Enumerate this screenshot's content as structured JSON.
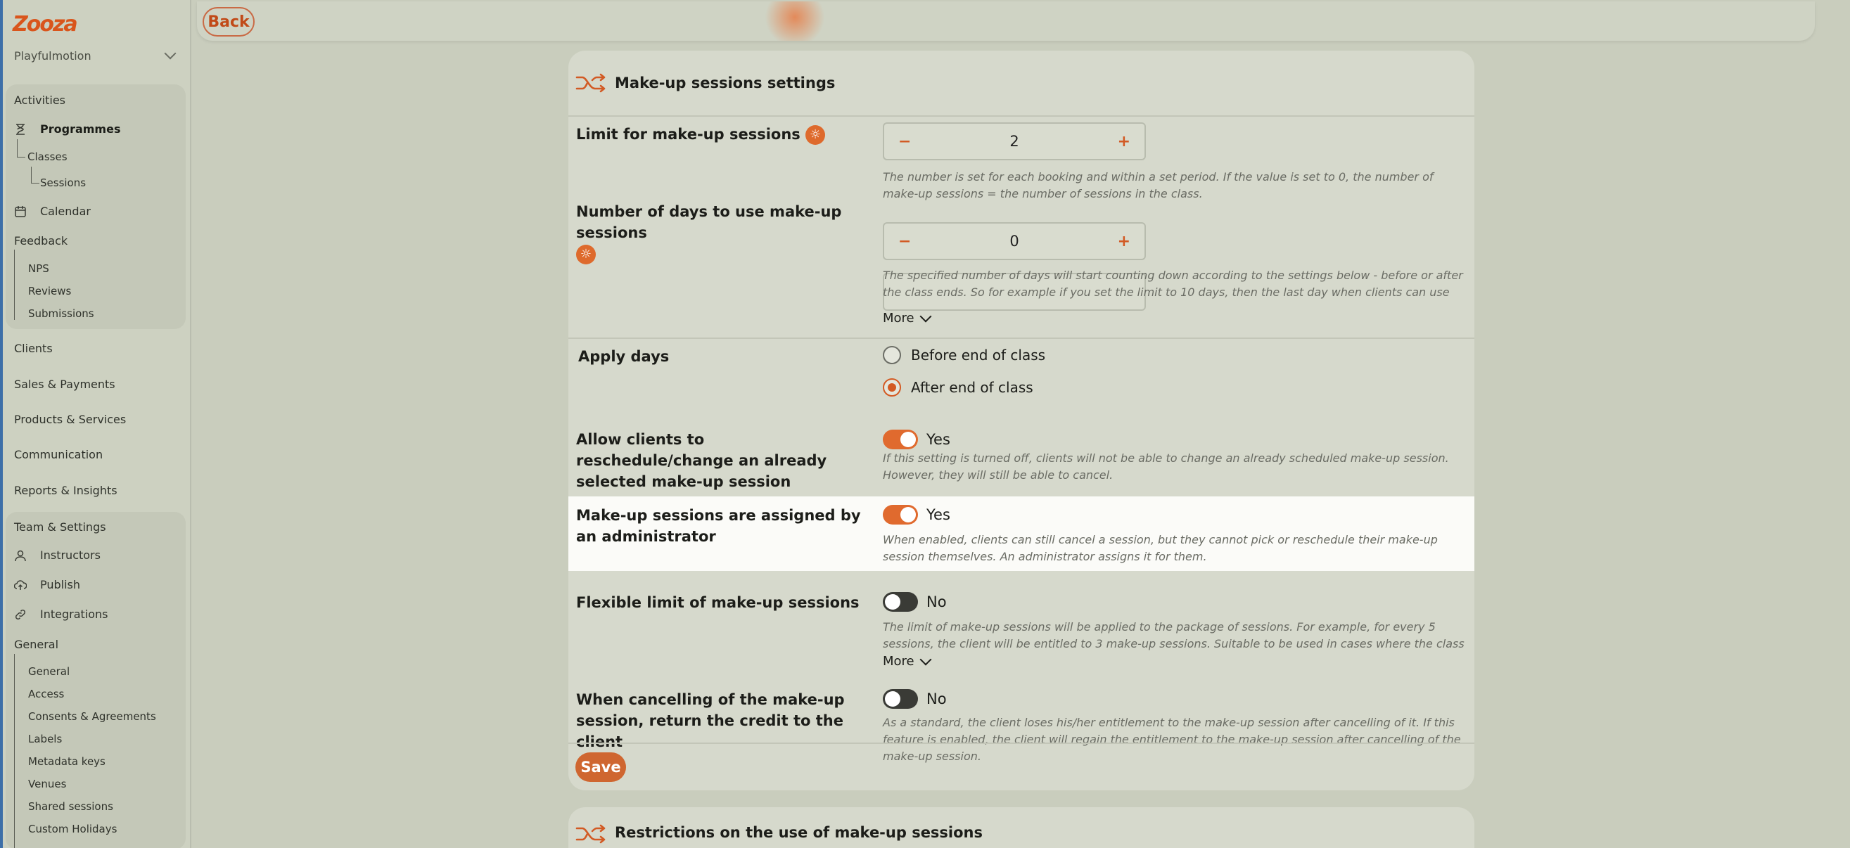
{
  "app": {
    "logo_text": "Zooza",
    "org_name": "Playfulmotion",
    "back_label": "Back"
  },
  "sidebar": {
    "activities": "Activities",
    "programmes": "Programmes",
    "classes": "Classes",
    "sessions": "Sessions",
    "calendar": "Calendar",
    "feedback": "Feedback",
    "nps": "NPS",
    "reviews": "Reviews",
    "submissions": "Submissions",
    "clients": "Clients",
    "sales": "Sales & Payments",
    "products": "Products & Services",
    "communication": "Communication",
    "reports": "Reports & Insights",
    "team": "Team & Settings",
    "instructors": "Instructors",
    "publish": "Publish",
    "integrations": "Integrations",
    "general": "General",
    "general_sub": "General",
    "access": "Access",
    "consents": "Consents & Agreements",
    "labels": "Labels",
    "metadata": "Metadata keys",
    "venues": "Venues",
    "shared_sessions": "Shared sessions",
    "custom_holidays": "Custom Holidays"
  },
  "card": {
    "title": "Make-up sessions settings",
    "limit": {
      "label": "Limit for make-up sessions",
      "value": "2",
      "minus": "−",
      "plus": "+",
      "help": "The number is set for each booking and within a set period. If the value is set to 0, the number of make-up sessions = the number of sessions in the class."
    },
    "days": {
      "label": "Number of days to use make-up sessions",
      "value": "0",
      "minus": "−",
      "plus": "+",
      "help": "The specified number of days will start counting down according to the settings below - before or after the class ends. So for example if you set the limit to 10 days, then the last day when clients can use their make-up…",
      "more": "More"
    },
    "apply": {
      "label": "Apply days",
      "option1": "Before end of class",
      "option2": "After end of class",
      "selected": "After end of class"
    },
    "reschedule": {
      "label": "Allow clients to reschedule/change an already selected make-up session",
      "state": "Yes",
      "help": "If this setting is turned off, clients will not be able to change an already scheduled make-up session. However, they will still be able to cancel."
    },
    "admin": {
      "label": "Make-up sessions are assigned by an administrator",
      "state": "Yes",
      "help": "When enabled, clients can still cancel a session, but they cannot pick or reschedule their make-up session themselves. An administrator assigns it for them."
    },
    "flexible": {
      "label": "Flexible limit of make-up sessions",
      "state": "No",
      "help": "The limit of make-up sessions will be applied to the package of sessions. For example, for every 5 sessions, the client will be entitled to 3 make-up sessions. Suitable to be used in cases where the class may be extended…",
      "more": "More"
    },
    "credit": {
      "label": "When cancelling of the make-up session, return the credit to the client",
      "state": "No",
      "help": "As a standard, the client loses his/her entitlement to the make-up session after cancelling of it. If this feature is enabled, the client will regain the entitlement to the make-up session after cancelling of the make-up session."
    },
    "save_label": "Save"
  },
  "card2": {
    "title": "Restrictions on the use of make-up sessions"
  },
  "colors": {
    "accent": "#de6a2c",
    "toggle_off": "#3a3b36",
    "highlight_row": "#fbfbf8"
  }
}
